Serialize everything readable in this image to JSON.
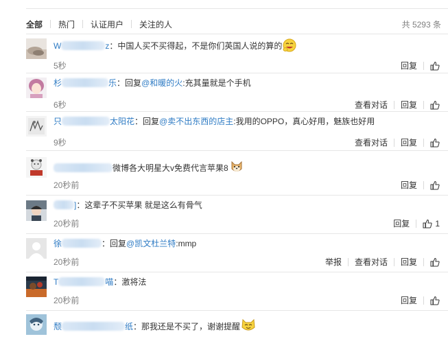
{
  "tabs": [
    {
      "label": "全部",
      "active": true
    },
    {
      "label": "热门",
      "active": false
    },
    {
      "label": "认证用户",
      "active": false
    },
    {
      "label": "关注的人",
      "active": false
    }
  ],
  "total": "共 5293 条",
  "actions": {
    "report": "举报",
    "view_conversation": "查看对话",
    "reply": "回复"
  },
  "comments": [
    {
      "user_pre": "W",
      "user_post": "z",
      "sep": "：",
      "text": "中国人买不买得起，不是你们英国人说的算的",
      "time": "5秒",
      "emoji": "laughing-emoji"
    },
    {
      "user_pre": "杉",
      "user_post": "乐",
      "sep": "：",
      "reply": "回复",
      "mention": "@和暖的火",
      "text": ":充其量就是个手机",
      "time": "6秒",
      "view_conversation": true
    },
    {
      "user_pre": "只",
      "user_post": "太阳花",
      "sep": "：",
      "reply": "回复",
      "mention": "@卖不出东西的店主",
      "text": ":我用的OPPO，真心好用，魅族也好用",
      "time": "9秒",
      "view_conversation": true
    },
    {
      "user_pre": "",
      "user_post": "",
      "sep": "",
      "text": "微博各大明星大v免费代言苹果8",
      "time": "20秒前",
      "emoji": "doge-emoji"
    },
    {
      "user_pre": "",
      "user_post": "]",
      "sep": "：",
      "text": "这辈子不买苹果 就是这么有骨气",
      "time": "20秒前",
      "like_count": "1"
    },
    {
      "user_pre": "徐",
      "user_post": "",
      "sep": "：",
      "reply": "回复",
      "mention": "@凯文杜兰特",
      "text": ":mmp",
      "time": "20秒前",
      "report": true,
      "view_conversation": true
    },
    {
      "user_pre": "T",
      "user_post": "喵",
      "sep": "：",
      "text": "激将法",
      "time": "20秒前"
    },
    {
      "user_pre": "颓",
      "user_post": "纸",
      "sep": "：",
      "text": "那我还是不买了，谢谢提醒",
      "time": "",
      "emoji": "smiling-cat-emoji"
    }
  ]
}
